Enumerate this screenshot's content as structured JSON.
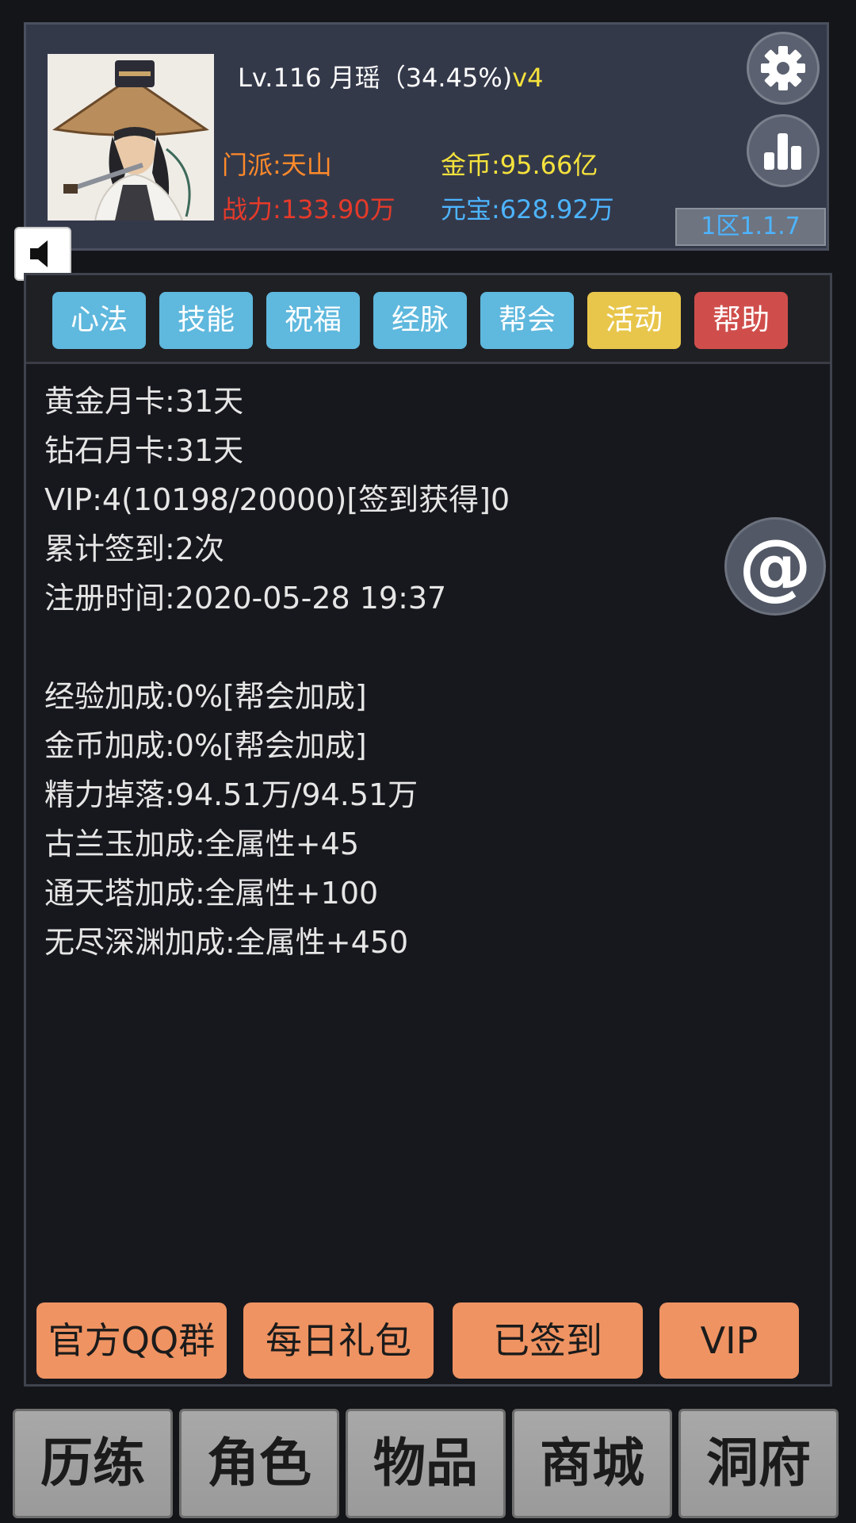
{
  "header": {
    "title_prefix": "Lv.116 月瑶（34.45%)",
    "vip_tag": "v4",
    "sect": "门派:天山",
    "power": "战力:133.90万",
    "gold": "金币:95.66亿",
    "yuanbao": "元宝:628.92万",
    "server": "1区1.1.7"
  },
  "icons": {
    "settings": "gear-icon",
    "stats": "bar-chart-icon",
    "sound": "speaker-icon",
    "mail": "at-sign-icon"
  },
  "tabs": [
    {
      "label": "心法",
      "color": "#5fb8dd"
    },
    {
      "label": "技能",
      "color": "#5fb8dd"
    },
    {
      "label": "祝福",
      "color": "#5fb8dd"
    },
    {
      "label": "经脉",
      "color": "#5fb8dd"
    },
    {
      "label": "帮会",
      "color": "#5fb8dd"
    },
    {
      "label": "活动",
      "color": "#e8c64b"
    },
    {
      "label": "帮助",
      "color": "#cf4e4b"
    }
  ],
  "info": {
    "gold_card": "黄金月卡:31天",
    "diamond_card": "钻石月卡:31天",
    "vip": "VIP:4(10198/20000)[签到获得]0",
    "signin_total": "累计签到:2次",
    "register_time": "注册时间:2020-05-28 19:37",
    "exp_bonus": "经验加成:0%[帮会加成]",
    "gold_bonus": "金币加成:0%[帮会加成]",
    "energy_drop": "精力掉落:94.51万/94.51万",
    "gulan_bonus": "古兰玉加成:全属性+45",
    "tower_bonus": "通天塔加成:全属性+100",
    "abyss_bonus": "无尽深渊加成:全属性+450"
  },
  "actions": {
    "qq_group": "官方QQ群",
    "daily_gift": "每日礼包",
    "signed": "已签到",
    "vip": "VIP"
  },
  "nav": [
    "历练",
    "角色",
    "物品",
    "商城",
    "洞府"
  ],
  "colors": {
    "panel": "#34394a",
    "background": "#141519",
    "accent_orange": "#ef9362",
    "gold": "#f5e23c",
    "blue": "#4db4ff",
    "red": "#e53a2a"
  }
}
